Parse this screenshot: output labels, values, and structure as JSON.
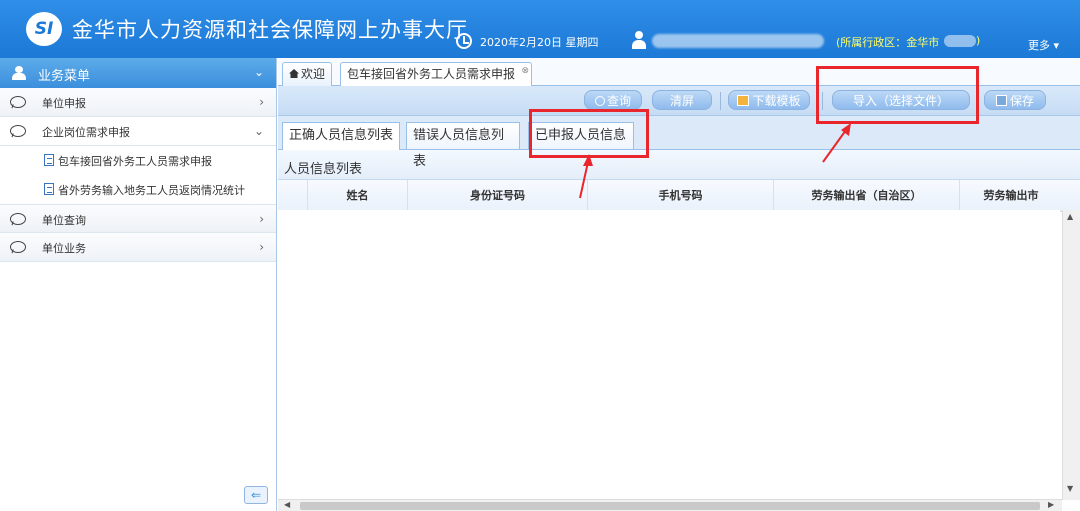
{
  "header": {
    "logo_text": "SI",
    "title": "金华市人力资源和社会保障网上办事大厅",
    "date": "2020年2月20日 星期四",
    "region_prefix": "(所属行政区：金华市",
    "region_suffix": ")",
    "more": "更多"
  },
  "sidebar": {
    "title": "业务菜单",
    "items": [
      {
        "label": "单位申报"
      },
      {
        "label": "企业岗位需求申报"
      },
      {
        "label": "单位查询"
      },
      {
        "label": "单位业务"
      }
    ],
    "sub_items": [
      {
        "label": "包车接回省外务工人员需求申报"
      },
      {
        "label": "省外劳务输入地务工人员返岗情况统计"
      }
    ]
  },
  "tabs": {
    "welcome": "欢迎",
    "current": "包车接回省外务工人员需求申报"
  },
  "toolbar": {
    "query": "查询",
    "clear": "清屏",
    "download": "下载模板",
    "import": "导入（选择文件）",
    "save": "保存"
  },
  "subtabs": {
    "correct": "正确人员信息列表",
    "error": "错误人员信息列表",
    "submitted": "已申报人员信息"
  },
  "list": {
    "title": "人员信息列表",
    "columns": [
      "姓名",
      "身份证号码",
      "手机号码",
      "劳务输出省（自治区）",
      "劳务输出市"
    ]
  },
  "colors": {
    "header_blue": "#1c79d6",
    "highlight_red": "#e8262c",
    "region_yellow": "#ffff66"
  }
}
